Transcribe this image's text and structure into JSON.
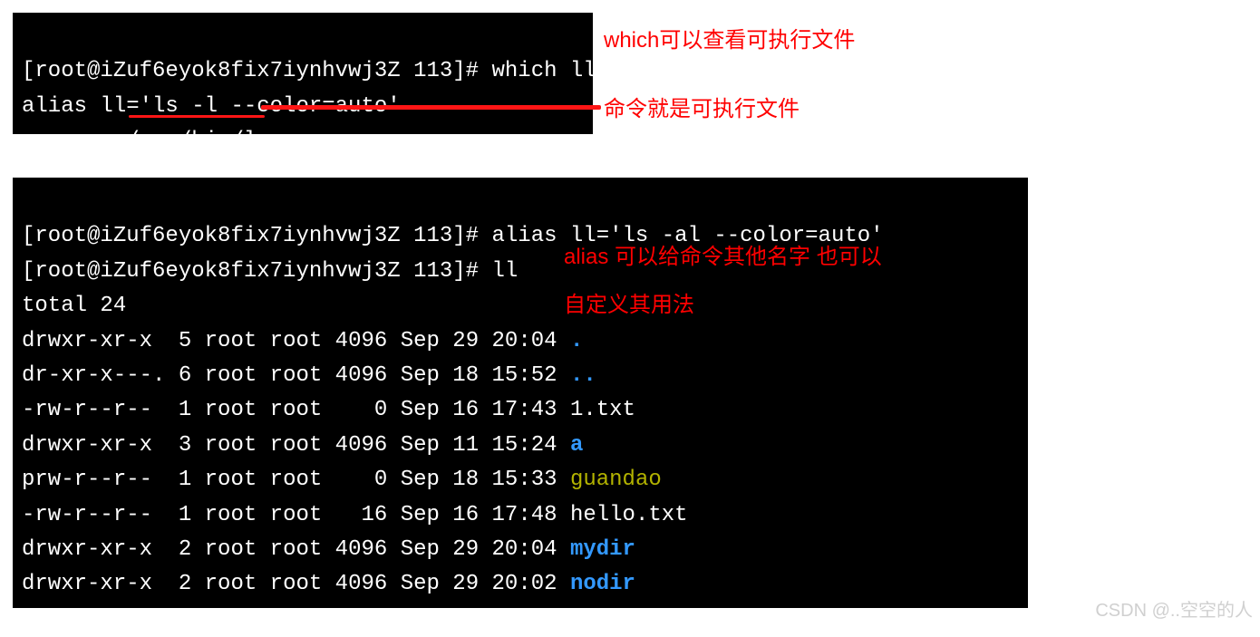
{
  "annotations": {
    "which_note": "which可以查看可执行文件",
    "cmd_note": "命令就是可执行文件",
    "alias_note_l1": "alias 可以给命令其他名字  也可以",
    "alias_note_l2": "自定义其用法"
  },
  "terminal1": {
    "prompt": "[root@iZuf6eyok8fix7iynhvwj3Z 113]# ",
    "cmd1": "which ll",
    "out1": "alias ll='ls -l --color=auto'",
    "out2": "\t/usr/bin/ls"
  },
  "terminal2": {
    "prompt": "[root@iZuf6eyok8fix7iynhvwj3Z 113]# ",
    "cmd1": "alias ll='ls -al --color=auto'",
    "cmd2": "ll",
    "total": "total 24",
    "rows": [
      {
        "perm": "drwxr-xr-x ",
        "links": " 5",
        "owner": " root",
        "group": " root",
        "size": " 4096",
        "date": " Sep 29 20:04 ",
        "name": ".",
        "color": "dir"
      },
      {
        "perm": "dr-xr-x---.",
        "links": " 6",
        "owner": " root",
        "group": " root",
        "size": " 4096",
        "date": " Sep 18 15:52 ",
        "name": "..",
        "color": "dir"
      },
      {
        "perm": "-rw-r--r-- ",
        "links": " 1",
        "owner": " root",
        "group": " root",
        "size": "    0",
        "date": " Sep 16 17:43 ",
        "name": "1.txt",
        "color": "plain"
      },
      {
        "perm": "drwxr-xr-x ",
        "links": " 3",
        "owner": " root",
        "group": " root",
        "size": " 4096",
        "date": " Sep 11 15:24 ",
        "name": "a",
        "color": "dir"
      },
      {
        "perm": "prw-r--r-- ",
        "links": " 1",
        "owner": " root",
        "group": " root",
        "size": "    0",
        "date": " Sep 18 15:33 ",
        "name": "guandao",
        "color": "pipe"
      },
      {
        "perm": "-rw-r--r-- ",
        "links": " 1",
        "owner": " root",
        "group": " root",
        "size": "   16",
        "date": " Sep 16 17:48 ",
        "name": "hello.txt",
        "color": "plain"
      },
      {
        "perm": "drwxr-xr-x ",
        "links": " 2",
        "owner": " root",
        "group": " root",
        "size": " 4096",
        "date": " Sep 29 20:04 ",
        "name": "mydir",
        "color": "dir"
      },
      {
        "perm": "drwxr-xr-x ",
        "links": " 2",
        "owner": " root",
        "group": " root",
        "size": " 4096",
        "date": " Sep 29 20:02 ",
        "name": "nodir",
        "color": "dir"
      }
    ]
  },
  "watermark": "CSDN @..空空的人"
}
